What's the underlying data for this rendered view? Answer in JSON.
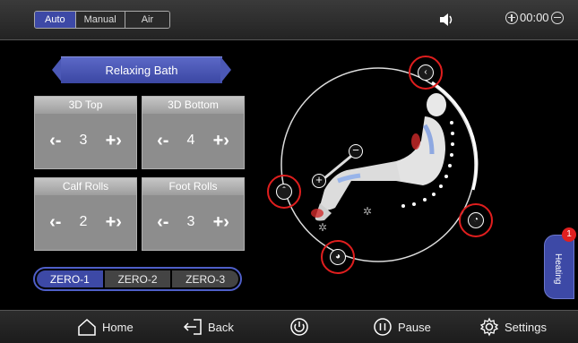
{
  "modes": [
    {
      "label": "Auto",
      "active": true
    },
    {
      "label": "Manual",
      "active": false
    },
    {
      "label": "Air",
      "active": false
    }
  ],
  "timer": {
    "value": "00:00"
  },
  "program": {
    "name": "Relaxing Bath"
  },
  "tiles": [
    {
      "title": "3D Top",
      "value": "3"
    },
    {
      "title": "3D Bottom",
      "value": "4"
    },
    {
      "title": "Calf Rolls",
      "value": "2"
    },
    {
      "title": "Foot Rolls",
      "value": "3"
    }
  ],
  "zero_buttons": [
    {
      "label": "ZERO-1",
      "active": true
    },
    {
      "label": "ZERO-2",
      "active": false
    },
    {
      "label": "ZERO-3",
      "active": false
    }
  ],
  "heating": {
    "label": "Heating",
    "badge": "1"
  },
  "bottom_nav": {
    "home": "Home",
    "back": "Back",
    "pause": "Pause",
    "settings": "Settings"
  },
  "colors": {
    "accent": "#3d49a6",
    "highlight": "#e01e1e"
  },
  "icons": [
    "speaker-icon",
    "plus-icon",
    "minus-icon",
    "home-icon",
    "back-icon",
    "power-icon",
    "pause-icon",
    "gear-icon"
  ]
}
